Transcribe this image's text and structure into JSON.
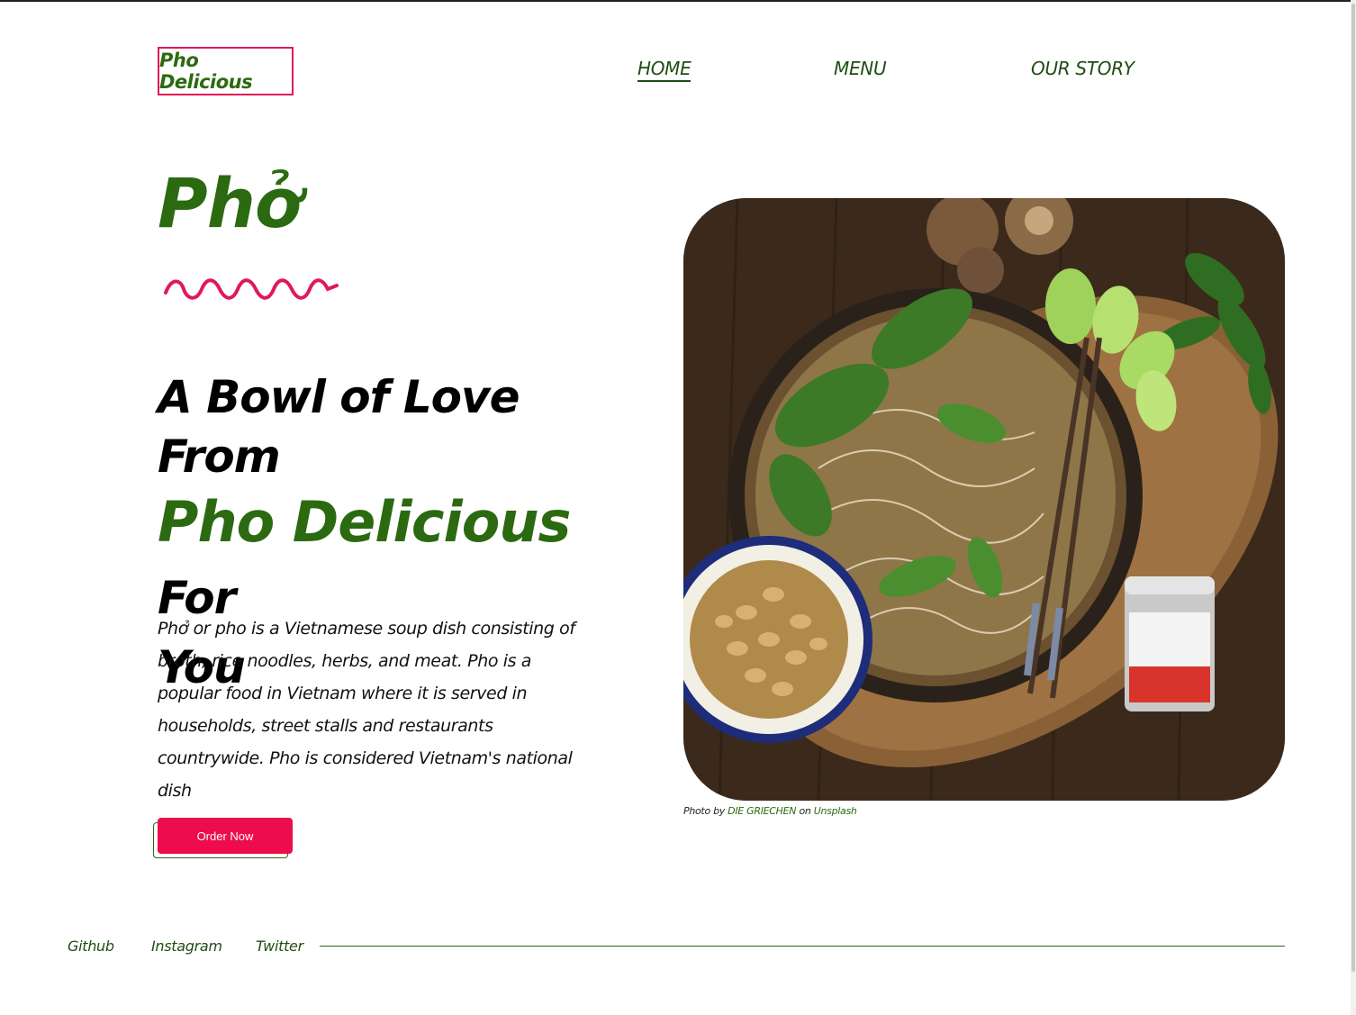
{
  "header": {
    "logo_text": "Pho Delicious",
    "nav": [
      {
        "label": "HOME",
        "active": true
      },
      {
        "label": "MENU",
        "active": false
      },
      {
        "label": "OUR STORY",
        "active": false
      }
    ]
  },
  "hero": {
    "title": "Phở",
    "headline_line1": "A Bowl of Love From",
    "headline_brand": "Pho Delicious",
    "headline_for": "For",
    "headline_line3": "You",
    "description": "Phở or pho is a Vietnamese soup dish consisting of broth, rice noodles, herbs, and meat. Pho is a popular food in Vietnam where it is served in households, street stalls and restaurants countrywide. Pho is considered Vietnam's national dish",
    "cta_label": "Order Now"
  },
  "photo": {
    "credit_prefix": "Photo by",
    "credit_author": "DIE GRIECHEN",
    "credit_on": "on",
    "credit_source": "Unsplash"
  },
  "footer": {
    "links": [
      "Github",
      "Instagram",
      "Twitter"
    ]
  },
  "colors": {
    "brand_green": "#2b6a11",
    "nav_green": "#1f4d14",
    "accent_pink": "#e0195a",
    "cta_red": "#ed0c4c"
  }
}
